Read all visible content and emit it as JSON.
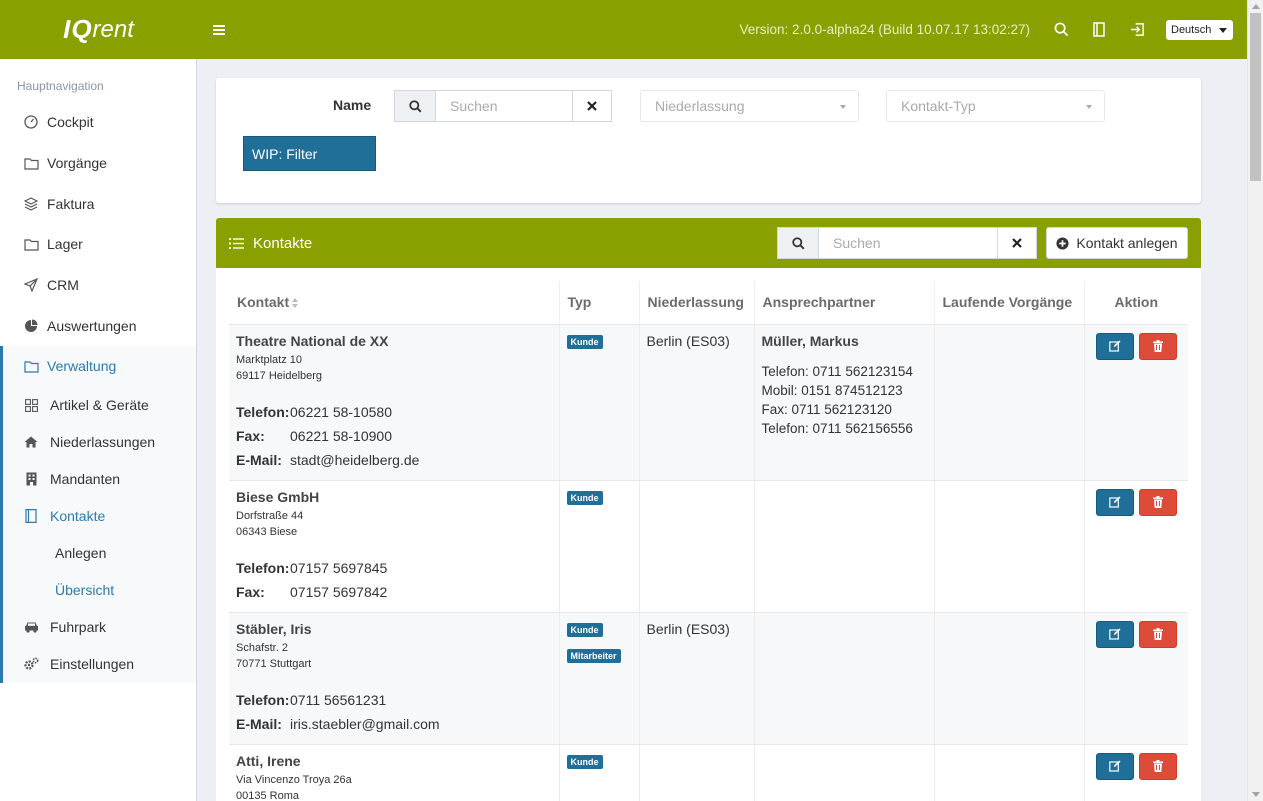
{
  "app": {
    "logo_bold": "IQ",
    "logo_rest": "rent",
    "version": "Version: 2.0.0-alpha24 (Build 10.07.17 13:02:27)",
    "language": "Deutsch"
  },
  "sidebar": {
    "header": "Hauptnavigation",
    "items": [
      {
        "label": "Cockpit",
        "icon": "gauge-icon"
      },
      {
        "label": "Vorgänge",
        "icon": "folder-icon"
      },
      {
        "label": "Faktura",
        "icon": "layers-icon"
      },
      {
        "label": "Lager",
        "icon": "folder-icon"
      },
      {
        "label": "CRM",
        "icon": "paper-plane-icon"
      },
      {
        "label": "Auswertungen",
        "icon": "pie-chart-icon"
      },
      {
        "label": "Verwaltung",
        "icon": "folder-icon"
      }
    ],
    "sub_items": [
      {
        "label": "Artikel & Geräte",
        "icon": "grid-icon"
      },
      {
        "label": "Niederlassungen",
        "icon": "home-icon"
      },
      {
        "label": "Mandanten",
        "icon": "building-icon"
      },
      {
        "label": "Kontakte",
        "icon": "address-book-icon"
      },
      {
        "label": "Fuhrpark",
        "icon": "car-icon"
      },
      {
        "label": "Einstellungen",
        "icon": "cogs-icon"
      }
    ],
    "subsub_items": [
      {
        "label": "Anlegen"
      },
      {
        "label": "Übersicht"
      }
    ]
  },
  "filter": {
    "name_label": "Name",
    "search_placeholder": "Suchen",
    "niederlassung_placeholder": "Niederlassung",
    "kontakttyp_placeholder": "Kontakt-Typ",
    "wip_button": "WIP: Filter"
  },
  "contacts": {
    "title": "Kontakte",
    "search_placeholder": "Suchen",
    "add_button": "Kontakt anlegen",
    "columns": [
      "Kontakt",
      "Typ",
      "Niederlassung",
      "Ansprechpartner",
      "Laufende Vorgänge",
      "Aktion"
    ],
    "rows": [
      {
        "name": "Theatre National de XX",
        "street": "Marktplatz 10",
        "city": "69117 Heidelberg",
        "lines": [
          {
            "label": "Telefon:",
            "value": "06221 58-10580"
          },
          {
            "label": "Fax:",
            "value": "06221 58-10900"
          },
          {
            "label": "E-Mail:",
            "value": "stadt@heidelberg.de"
          }
        ],
        "types": [
          "Kunde"
        ],
        "niederlassung": "Berlin (ES03)",
        "ansprechpartner": {
          "name": "Müller, Markus",
          "lines": [
            "Telefon: 0711 562123154",
            "Mobil: 0151 874512123",
            "Fax: 0711 562123120",
            "Telefon: 0711 562156556"
          ]
        }
      },
      {
        "name": "Biese GmbH",
        "street": "Dorfstraße 44",
        "city": "06343 Biese",
        "lines": [
          {
            "label": "Telefon:",
            "value": "07157 5697845"
          },
          {
            "label": "Fax:",
            "value": "07157 5697842"
          }
        ],
        "types": [
          "Kunde"
        ],
        "niederlassung": "",
        "ansprechpartner": null
      },
      {
        "name": "Stäbler, Iris",
        "street": "Schafstr. 2",
        "city": "70771 Stuttgart",
        "lines": [
          {
            "label": "Telefon:",
            "value": "0711 56561231"
          },
          {
            "label": "E-Mail:",
            "value": "iris.staebler@gmail.com"
          }
        ],
        "types": [
          "Kunde",
          "Mitarbeiter"
        ],
        "niederlassung": "Berlin (ES03)",
        "ansprechpartner": null
      },
      {
        "name": "Atti, Irene",
        "street": "Via Vincenzo Troya 26a",
        "city": "00135 Roma",
        "lines": [],
        "types": [
          "Kunde"
        ],
        "niederlassung": "",
        "ansprechpartner": null
      }
    ]
  },
  "colors": {
    "brand": "#8a9f00",
    "primary": "#1f6f99",
    "danger": "#dd4b39"
  }
}
